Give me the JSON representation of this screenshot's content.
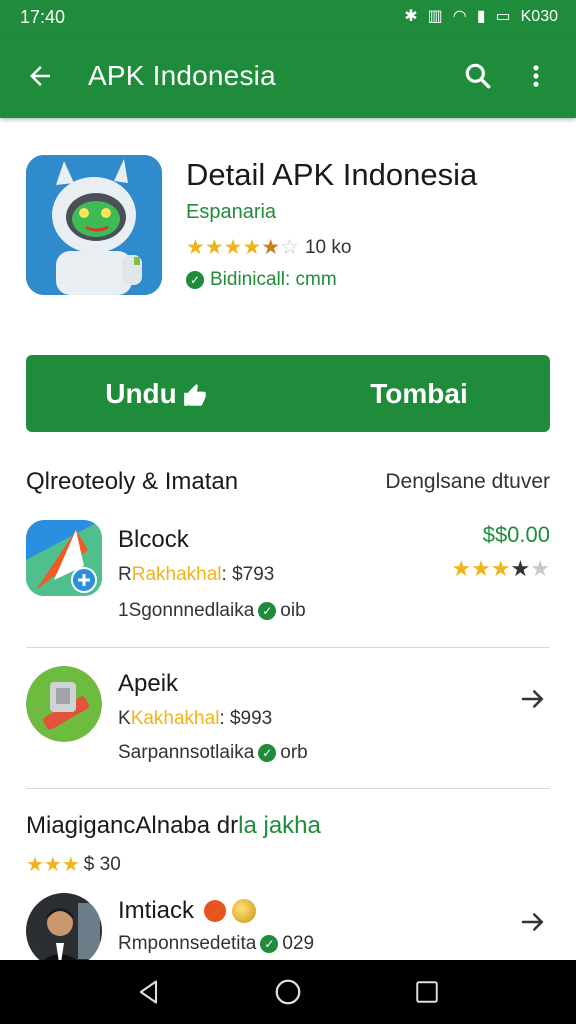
{
  "status": {
    "time": "17:40",
    "right_text": "K030"
  },
  "appbar": {
    "title": "APK Indonesia"
  },
  "app": {
    "name": "Detail APK Indonesia",
    "developer": "Espanaria",
    "rating_text": "10 ko",
    "verified_text": "Bidinicall: cmm"
  },
  "cta": {
    "left": "Undu",
    "right": "Tombai"
  },
  "section1": {
    "title": "Qlreoteoly & Imatan",
    "more": "Denglsane dtuver"
  },
  "items": [
    {
      "title": "Blcock",
      "sub_prefix": "Rakhakhal",
      "sub_suffix": ": $793",
      "meta_left": "1Sgonnnedlaika",
      "meta_right": "oib",
      "price": "$$0.00"
    },
    {
      "title": "Apeik",
      "sub_prefix": "Kakhakhal",
      "sub_suffix": ": $993",
      "meta_left": "Sarpannsotlaika",
      "meta_right": "orb"
    },
    {
      "title": "Imtiack",
      "meta_left": "Rmponnsedetita",
      "meta_right": "029"
    }
  ],
  "section2": {
    "title_black": "MiagigancAlnaba dr",
    "title_green": "la jakha",
    "rating_text": "$ 30"
  },
  "colors": {
    "primary": "#1e8c3a",
    "star": "#f0b31b",
    "navbar": "#000000"
  },
  "icons": [
    "back-arrow-icon",
    "search-icon",
    "more-vert-icon",
    "verified-check-icon",
    "chevron-right-icon",
    "nav-back-icon",
    "nav-home-icon",
    "nav-recents-icon"
  ]
}
